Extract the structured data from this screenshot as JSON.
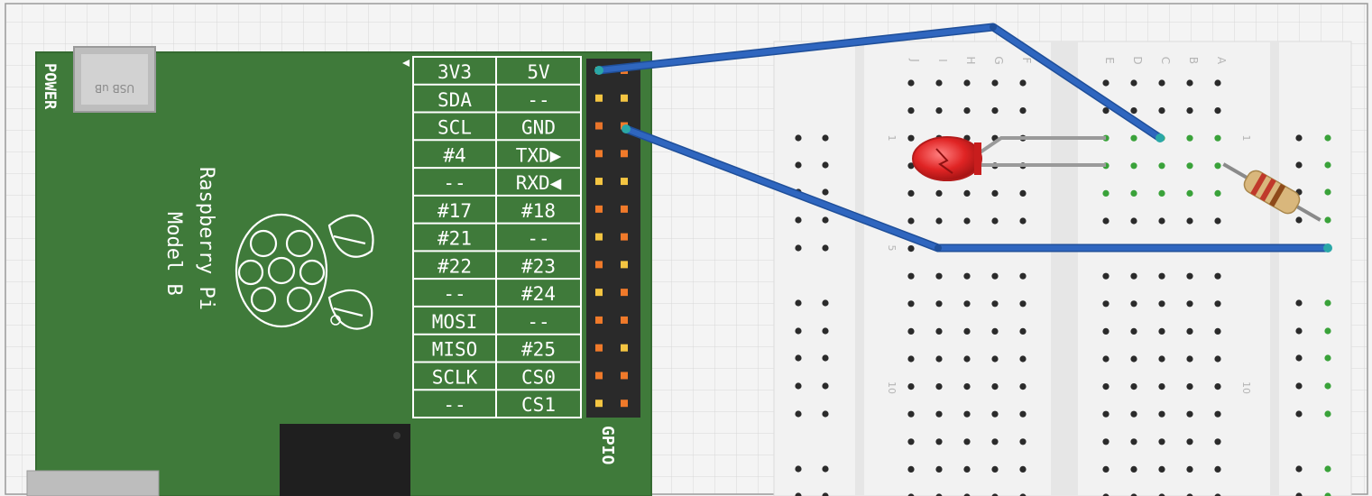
{
  "board": {
    "power_label": "POWER",
    "usb_label": "USB uB",
    "name_line1": "Raspberry Pi",
    "name_line2": "Model B",
    "gpio_label": "GPIO",
    "colors": {
      "pcb": "#3f7a3a",
      "pcb_edge": "#356a31",
      "silk": "#ffffff",
      "header": "#2a2a2a",
      "chip": "#1f1f1f"
    }
  },
  "pin_labels": {
    "left": [
      "3V3",
      "SDA",
      "SCL",
      "#4",
      "--",
      "#17",
      "#21",
      "#22",
      "--",
      "MOSI",
      "MISO",
      "SCLK",
      "--"
    ],
    "right": [
      "5V",
      "--",
      "GND",
      "TXD▶",
      "RXD◀",
      "#18",
      "--",
      "#23",
      "#24",
      "--",
      "#25",
      "CS0",
      "CS1"
    ]
  },
  "breadboard": {
    "column_letters": [
      "J",
      "I",
      "H",
      "G",
      "F",
      "E",
      "D",
      "C",
      "B",
      "A"
    ],
    "row_numbers": [
      "1",
      "5",
      "10"
    ],
    "colors": {
      "body": "#f2f2f2",
      "channel": "#e6e6e6",
      "hole": "#2b2b2b",
      "active_hole": "#3aa23a",
      "wire": "#2f66bf",
      "wire_dark": "#1f4f9a"
    }
  },
  "components": {
    "led": {
      "name": "LED",
      "color": "#e02424"
    },
    "resistor": {
      "name": "Resistor",
      "bands": [
        "#c0392b",
        "#c0392b",
        "#8e4a1a"
      ]
    }
  }
}
